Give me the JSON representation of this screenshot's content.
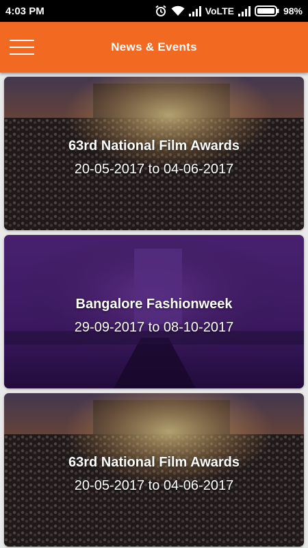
{
  "status_bar": {
    "time": "4:03 PM",
    "network": "VoLTE",
    "battery": "98%"
  },
  "app_bar": {
    "title": "News & Events",
    "menu_icon": "hamburger-menu-icon",
    "color": "#f26a21"
  },
  "events": [
    {
      "title": "63rd National Film Awards",
      "dates": "20-05-2017 to 04-06-2017",
      "theme": "concert-crowd"
    },
    {
      "title": "Bangalore Fashionweek",
      "dates": "29-09-2017 to 08-10-2017",
      "theme": "purple-runway"
    },
    {
      "title": "63rd National Film Awards",
      "dates": "20-05-2017 to 04-06-2017",
      "theme": "concert-crowd"
    }
  ]
}
